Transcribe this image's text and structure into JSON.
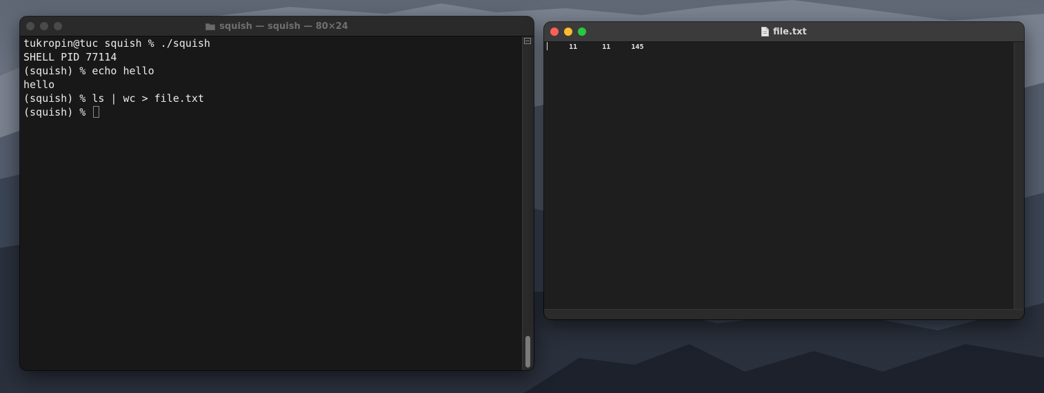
{
  "terminal": {
    "title": "squish — squish — 80×24",
    "lines": [
      "tukropin@tuc squish % ./squish",
      "SHELL PID 77114",
      "(squish) % echo hello",
      "hello",
      "(squish) % ls | wc > file.txt",
      "(squish) % "
    ]
  },
  "editor": {
    "title": "file.txt",
    "content": "     11      11     145"
  },
  "colors": {
    "close": "#ff5f57",
    "minimize": "#febc2e",
    "zoom": "#28c840",
    "inactive_light": "#4a4a4a"
  },
  "icons": {
    "terminal_title_icon": "folder-icon",
    "editor_title_icon": "document-icon"
  }
}
